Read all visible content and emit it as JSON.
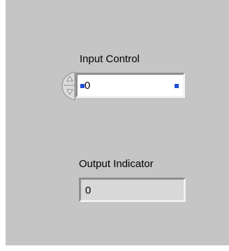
{
  "panel": {
    "background": "#c5c5c5"
  },
  "input_control": {
    "label": "Input Control",
    "value": "0",
    "increment_icon": "increment-arrow-icon",
    "decrement_icon": "decrement-arrow-icon",
    "terminal_color": "#1f4fd6"
  },
  "output_indicator": {
    "label": "Output Indicator",
    "value": "0"
  }
}
